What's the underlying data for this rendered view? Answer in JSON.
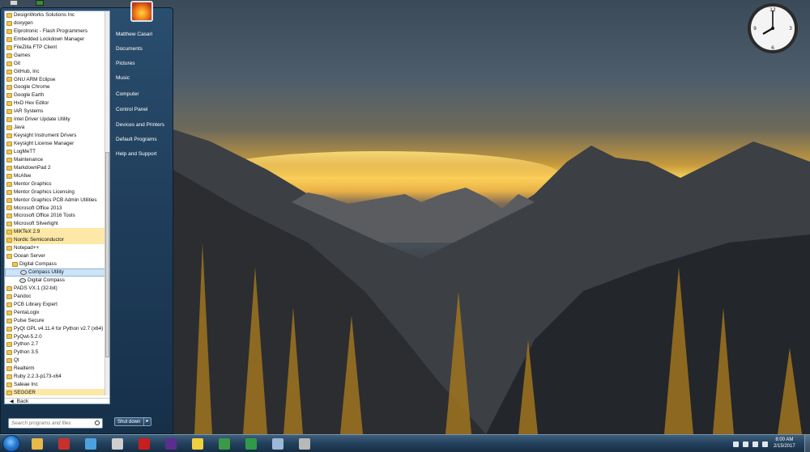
{
  "start_menu": {
    "programs": [
      {
        "label": "DesignWorks Solutions Inc",
        "type": "folder",
        "state": ""
      },
      {
        "label": "doxygen",
        "type": "folder",
        "state": ""
      },
      {
        "label": "Elprotronic - Flash Programmers",
        "type": "folder",
        "state": ""
      },
      {
        "label": "Embedded Lockdown Manager",
        "type": "folder",
        "state": ""
      },
      {
        "label": "FileZilla FTP Client",
        "type": "folder",
        "state": ""
      },
      {
        "label": "Games",
        "type": "folder",
        "state": ""
      },
      {
        "label": "Git",
        "type": "folder",
        "state": ""
      },
      {
        "label": "GitHub, Inc",
        "type": "folder",
        "state": ""
      },
      {
        "label": "GNU ARM Eclipse",
        "type": "folder",
        "state": ""
      },
      {
        "label": "Google Chrome",
        "type": "folder",
        "state": ""
      },
      {
        "label": "Google Earth",
        "type": "folder",
        "state": ""
      },
      {
        "label": "HxD Hex Editor",
        "type": "folder",
        "state": ""
      },
      {
        "label": "IAR Systems",
        "type": "folder",
        "state": ""
      },
      {
        "label": "Intel Driver Update Utility",
        "type": "folder",
        "state": ""
      },
      {
        "label": "Java",
        "type": "folder",
        "state": ""
      },
      {
        "label": "Keysight Instrument Drivers",
        "type": "folder",
        "state": ""
      },
      {
        "label": "Keysight License Manager",
        "type": "folder",
        "state": ""
      },
      {
        "label": "LogMeTT",
        "type": "folder",
        "state": ""
      },
      {
        "label": "Maintenance",
        "type": "folder",
        "state": ""
      },
      {
        "label": "MarkdownPad 2",
        "type": "folder",
        "state": ""
      },
      {
        "label": "McAfee",
        "type": "folder",
        "state": ""
      },
      {
        "label": "Mentor Graphics",
        "type": "folder",
        "state": ""
      },
      {
        "label": "Mentor Graphics Licensing",
        "type": "folder",
        "state": ""
      },
      {
        "label": "Mentor Graphics PCB Admin Utilities",
        "type": "folder",
        "state": ""
      },
      {
        "label": "Microsoft Office 2013",
        "type": "folder",
        "state": ""
      },
      {
        "label": "Microsoft Office 2016 Tools",
        "type": "folder",
        "state": ""
      },
      {
        "label": "Microsoft Silverlight",
        "type": "folder",
        "state": ""
      },
      {
        "label": "MiKTeX 2.9",
        "type": "folder",
        "state": "hl"
      },
      {
        "label": "Nordic Semiconductor",
        "type": "folder",
        "state": "hl"
      },
      {
        "label": "Notepad++",
        "type": "folder",
        "state": ""
      },
      {
        "label": "Ocean Server",
        "type": "folder",
        "state": ""
      },
      {
        "label": "Digital Compass",
        "type": "folder",
        "state": "ind1"
      },
      {
        "label": "Compass Utility",
        "type": "app",
        "state": "ind2 sel"
      },
      {
        "label": "Digital Compass",
        "type": "app",
        "state": "ind2"
      },
      {
        "label": "PADS VX.1 (32-bit)",
        "type": "folder",
        "state": ""
      },
      {
        "label": "Pandoc",
        "type": "folder",
        "state": ""
      },
      {
        "label": "PCB Library Expert",
        "type": "folder",
        "state": ""
      },
      {
        "label": "PentaLogix",
        "type": "folder",
        "state": ""
      },
      {
        "label": "Pulse Secure",
        "type": "folder",
        "state": ""
      },
      {
        "label": "PyQt GPL v4.11.4 for Python v2.7 (x64)",
        "type": "folder",
        "state": ""
      },
      {
        "label": "PyQwt-5.2.0",
        "type": "folder",
        "state": ""
      },
      {
        "label": "Python 2.7",
        "type": "folder",
        "state": ""
      },
      {
        "label": "Python 3.5",
        "type": "folder",
        "state": ""
      },
      {
        "label": "Qt",
        "type": "folder",
        "state": ""
      },
      {
        "label": "Realterm",
        "type": "folder",
        "state": ""
      },
      {
        "label": "Ruby 2.2.3-p173-x64",
        "type": "folder",
        "state": ""
      },
      {
        "label": "Saleae Inc",
        "type": "folder",
        "state": ""
      },
      {
        "label": "SEGGER",
        "type": "folder",
        "state": "hl"
      }
    ],
    "back_label": "Back",
    "search_placeholder": "Search programs and files",
    "right_links": {
      "user": "Matthew Casari",
      "documents": "Documents",
      "pictures": "Pictures",
      "music": "Music",
      "computer": "Computer",
      "control_panel": "Control Panel",
      "devices": "Devices and Printers",
      "default_programs": "Default Programs",
      "help": "Help and Support"
    },
    "shutdown_label": "Shut down"
  },
  "taskbar": {
    "pinned": [
      {
        "name": "explorer",
        "color": "#e8b84a"
      },
      {
        "name": "apps",
        "color": "#c9302c"
      },
      {
        "name": "maps",
        "color": "#4aa3df"
      },
      {
        "name": "calculator",
        "color": "#cfcfcf"
      },
      {
        "name": "pdf",
        "color": "#c81e1e"
      },
      {
        "name": "visual-studio",
        "color": "#5c2d91"
      },
      {
        "name": "sticky-notes",
        "color": "#f1d040"
      },
      {
        "name": "chrome",
        "color": "#3a9a48"
      },
      {
        "name": "globe",
        "color": "#2e9a4a"
      },
      {
        "name": "compass-app",
        "color": "#9bb8d8"
      },
      {
        "name": "tool",
        "color": "#b8b8b8"
      }
    ],
    "time": "8:00 AM",
    "date": "2/15/2017"
  },
  "colors": {
    "annotation_arrow": "#d9231c",
    "highlight": "#fde8a8"
  }
}
